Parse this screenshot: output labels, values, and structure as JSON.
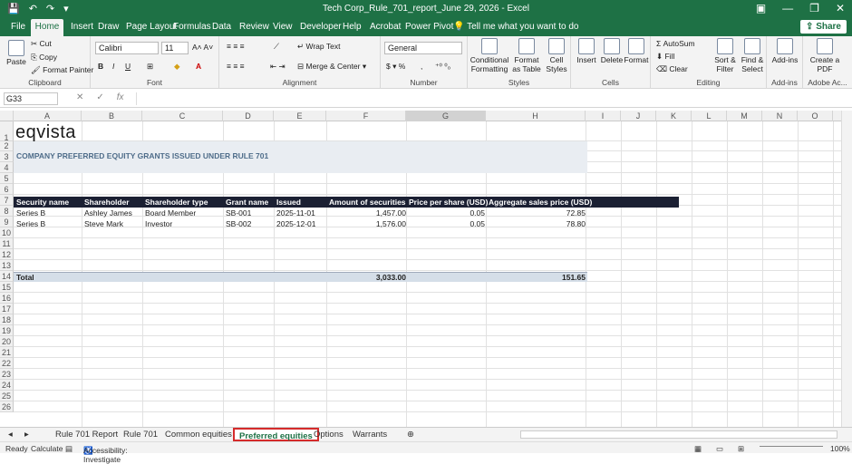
{
  "window": {
    "title": "Tech Corp_Rule_701_report_June 29, 2026  -  Excel"
  },
  "ribbon_tabs": [
    "File",
    "Home",
    "Insert",
    "Draw",
    "Page Layout",
    "Formulas",
    "Data",
    "Review",
    "View",
    "Developer",
    "Help",
    "Acrobat",
    "Power Pivot"
  ],
  "tell_me": "Tell me what you want to do",
  "share": "Share",
  "ribbon": {
    "clipboard": {
      "paste": "Paste",
      "cut": "Cut",
      "copy": "Copy",
      "format_painter": "Format Painter",
      "label": "Clipboard"
    },
    "font": {
      "name": "Calibri",
      "size": "11",
      "label": "Font"
    },
    "alignment": {
      "wrap": "Wrap Text",
      "merge": "Merge & Center",
      "label": "Alignment"
    },
    "number": {
      "format": "General",
      "label": "Number"
    },
    "styles": {
      "conditional": "Conditional Formatting",
      "format_table": "Format as Table",
      "cell_styles": "Cell Styles",
      "label": "Styles"
    },
    "cells": {
      "insert": "Insert",
      "delete": "Delete",
      "format": "Format",
      "label": "Cells"
    },
    "editing": {
      "autosum": "AutoSum",
      "fill": "Fill",
      "clear": "Clear",
      "sort": "Sort & Filter",
      "find": "Find & Select",
      "label": "Editing"
    },
    "addins": {
      "addins": "Add-ins",
      "label": "Add-ins"
    },
    "adobe": {
      "create_pdf": "Create a PDF",
      "label": "Adobe Ac..."
    }
  },
  "formula_bar": {
    "name_box": "G33",
    "formula": ""
  },
  "columns": [
    "A",
    "B",
    "C",
    "D",
    "E",
    "F",
    "G",
    "H",
    "I",
    "J",
    "K",
    "L",
    "M",
    "N",
    "O"
  ],
  "rows": [
    "1",
    "2",
    "3",
    "4",
    "5",
    "6",
    "7",
    "8",
    "9",
    "10",
    "11",
    "12",
    "13",
    "14",
    "15",
    "16",
    "17",
    "18",
    "19",
    "20",
    "21",
    "22",
    "23",
    "24",
    "25",
    "26"
  ],
  "sheet": {
    "logo": "eqvista",
    "subtitle": "COMPANY PREFERRED EQUITY GRANTS ISSUED UNDER RULE 701",
    "headers": [
      "Security name",
      "Shareholder",
      "Shareholder type",
      "Grant name",
      "Issued",
      "Amount of securities",
      "Price per share (USD)",
      "Aggregate sales price (USD)"
    ],
    "rows": [
      [
        "Series B",
        "Ashley James",
        "Board Member",
        "SB-001",
        "2025-11-01",
        "1,457.00",
        "0.05",
        "72.85"
      ],
      [
        "Series B",
        "Steve Mark",
        "Investor",
        "SB-002",
        "2025-12-01",
        "1,576.00",
        "0.05",
        "78.80"
      ]
    ],
    "total_label": "Total",
    "total_amount": "3,033.00",
    "total_aggregate": "151.65"
  },
  "sheet_tabs": [
    "Rule 701 Report",
    "Rule 701",
    "Common equities",
    "Preferred equities",
    "Options",
    "Warrants"
  ],
  "active_sheet": "Preferred equities",
  "status": {
    "ready": "Ready",
    "calculate": "Calculate",
    "accessibility": "Accessibility: Investigate",
    "zoom": "100%"
  }
}
